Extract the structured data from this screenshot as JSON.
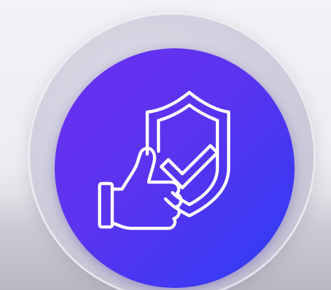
{
  "icon": {
    "name": "trust-badge",
    "parts": [
      "shield-icon",
      "checkmark-icon",
      "thumbs-up-icon"
    ],
    "stroke_color": "#ffffff"
  },
  "colors": {
    "badge_start": "#6a2ff0",
    "badge_end": "#2f3ef0",
    "background": "#f3f2f6",
    "glass": "#cdcbda"
  }
}
